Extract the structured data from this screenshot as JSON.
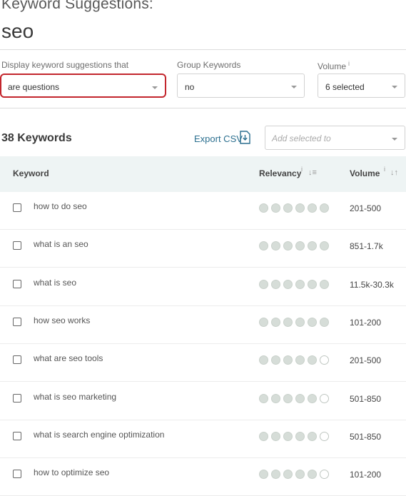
{
  "header": {
    "title": "Keyword Suggestions:",
    "keyword": "seo"
  },
  "filters": {
    "display": {
      "label": "Display keyword suggestions that",
      "value": "are questions"
    },
    "group": {
      "label": "Group Keywords",
      "value": "no"
    },
    "volume": {
      "label": "Volume",
      "info": "i",
      "value": "6 selected"
    }
  },
  "toolbar": {
    "count_label": "38 Keywords",
    "export_label": "Export CSV",
    "add_placeholder": "Add selected to"
  },
  "table": {
    "headers": {
      "keyword": "Keyword",
      "relevancy": "Relevancy",
      "volume": "Volume",
      "info": "i"
    },
    "rows": [
      {
        "keyword": "how to do seo",
        "relevancy": 6,
        "volume": "201-500"
      },
      {
        "keyword": "what is an seo",
        "relevancy": 6,
        "volume": "851-1.7k"
      },
      {
        "keyword": "what is seo",
        "relevancy": 6,
        "volume": "11.5k-30.3k"
      },
      {
        "keyword": "how seo works",
        "relevancy": 6,
        "volume": "101-200"
      },
      {
        "keyword": "what are seo tools",
        "relevancy": 5,
        "volume": "201-500"
      },
      {
        "keyword": "what is seo marketing",
        "relevancy": 5,
        "volume": "501-850"
      },
      {
        "keyword": "what is search engine optimization",
        "relevancy": 5,
        "volume": "501-850"
      },
      {
        "keyword": "how to optimize seo",
        "relevancy": 5,
        "volume": "101-200"
      }
    ],
    "relevancy_max": 6
  },
  "colors": {
    "accent_red": "#c3262d",
    "link_blue": "#2b6f8f",
    "header_bg": "#eef4f4",
    "dot_filled": "#d6ddd8"
  }
}
